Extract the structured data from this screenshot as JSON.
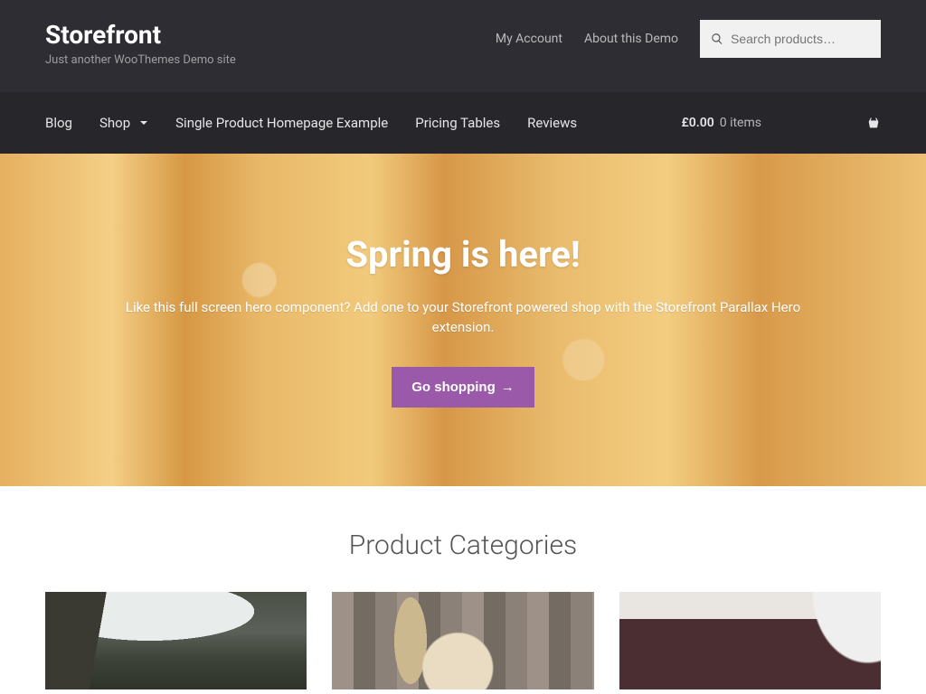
{
  "header": {
    "site_title": "Storefront",
    "site_desc": "Just another WooThemes Demo site",
    "secondary_nav": {
      "my_account": "My Account",
      "about_demo": "About this Demo"
    },
    "search": {
      "placeholder": "Search products…"
    }
  },
  "nav": {
    "blog": "Blog",
    "shop": "Shop",
    "single_product": "Single Product Homepage Example",
    "pricing_tables": "Pricing Tables",
    "reviews": "Reviews"
  },
  "cart": {
    "amount": "£0.00",
    "items": "0 items"
  },
  "hero": {
    "title": "Spring is here!",
    "text": "Like this full screen hero component? Add one to your Storefront powered shop with the Storefront Parallax Hero extension.",
    "button": "Go shopping",
    "arrow": "→"
  },
  "sections": {
    "categories_title": "Product Categories"
  }
}
